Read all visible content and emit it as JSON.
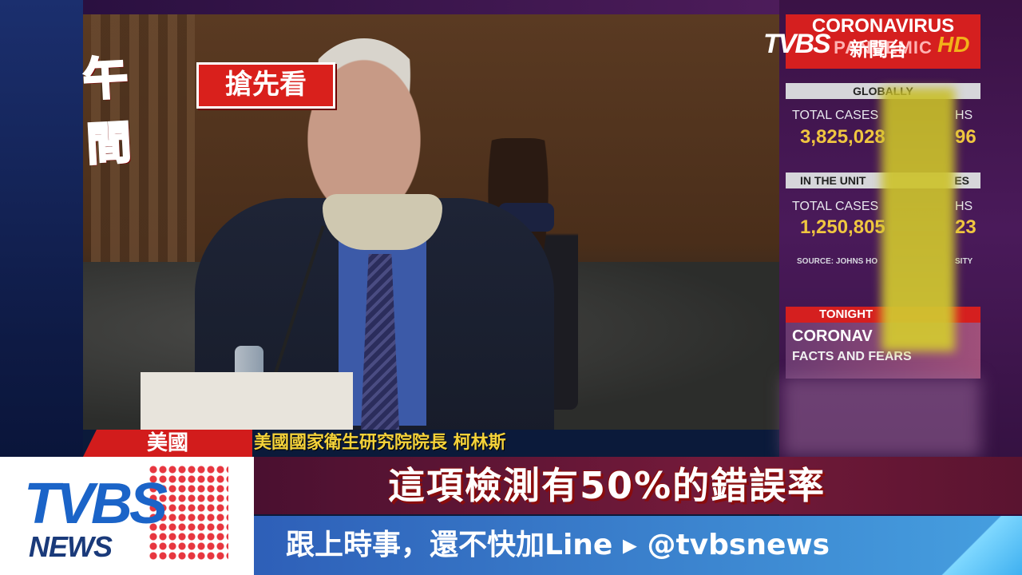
{
  "program_logo": {
    "main": "午間",
    "sub": "搶先看"
  },
  "channel_bug": {
    "brand": "TVBS",
    "channel": "新聞台",
    "quality": "HD"
  },
  "info_panel": {
    "header_line1": "CORONAVIRUS",
    "header_line2": "PANDEMIC",
    "global_title": "GLOBALLY",
    "global_cases_label": "TOTAL CASES",
    "global_deaths_label": "HS",
    "global_cases": "3,825,028",
    "global_deaths": "96",
    "us_title": "IN THE UNIT",
    "us_title_end": "ES",
    "us_cases_label": "TOTAL CASES",
    "us_deaths_label": "HS",
    "us_cases": "1,250,805",
    "us_deaths": "23",
    "source": "SOURCE: JOHNS HO",
    "source_end": "SITY",
    "tonight": "TONIGHT",
    "promo_title": "CORONAV",
    "promo_sub": "FACTS AND FEARS"
  },
  "lower_third": {
    "location": "美國",
    "speaker": "美國國家衛生研究院院長 柯林斯",
    "headline": "這項檢測有50%的錯誤率"
  },
  "brand_box": {
    "logo": "TVBS",
    "sub": "NEWS"
  },
  "ticker": {
    "text": "跟上時事，還不快加Line ▸ @tvbsnews"
  },
  "colors": {
    "accent_red": "#d51f1f",
    "number_yellow": "#f0c640",
    "ticker_blue": "#2e5fb8"
  }
}
